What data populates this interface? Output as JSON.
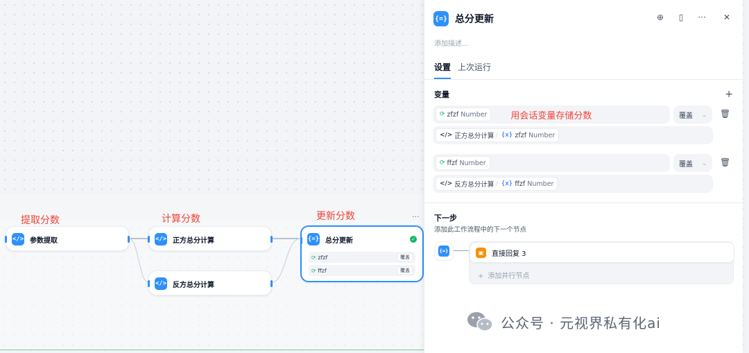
{
  "canvas": {
    "annotations": [
      "提取分数",
      "计算分数",
      "更新分数"
    ],
    "nodes": {
      "extract": {
        "title": "参数提取",
        "icon": "code-icon"
      },
      "pos_calc": {
        "title": "正方总分计算",
        "icon": "code-icon"
      },
      "neg_calc": {
        "title": "反方总分计算",
        "icon": "code-icon"
      },
      "update": {
        "title": "总分更新",
        "icon": "variable-assigner-icon",
        "vars": [
          {
            "name": "zfzf",
            "mode": "覆盖"
          },
          {
            "name": "ffzf",
            "mode": "覆盖"
          }
        ]
      }
    },
    "more_menu": "···"
  },
  "panel": {
    "title": "总分更新",
    "description_placeholder": "添加描述...",
    "tabs": [
      "设置",
      "上次运行"
    ],
    "variables_title": "变量",
    "add": "+",
    "variables": [
      {
        "var_name": "zfzf",
        "var_type": "Number",
        "note": "用会话变量存储分数",
        "mode": "覆盖",
        "source_node": "正方总分计算",
        "source_var": "zfzf",
        "source_type": "Number"
      },
      {
        "var_name": "ffzf",
        "var_type": "Number",
        "note": "",
        "mode": "覆盖",
        "source_node": "反方总分计算",
        "source_var": "ffzf",
        "source_type": "Number"
      }
    ],
    "next": {
      "title": "下一步",
      "subtitle": "添加此工作流程中的下一个节点",
      "item": "直接回复 3",
      "add_parallel": "添加并行节点"
    }
  },
  "watermark": "公众号 · 元视界私有化ai",
  "colors": {
    "accent": "#2e90fa",
    "annotation": "#f04438",
    "band": "#6fcf97",
    "reply": "#f79009"
  }
}
